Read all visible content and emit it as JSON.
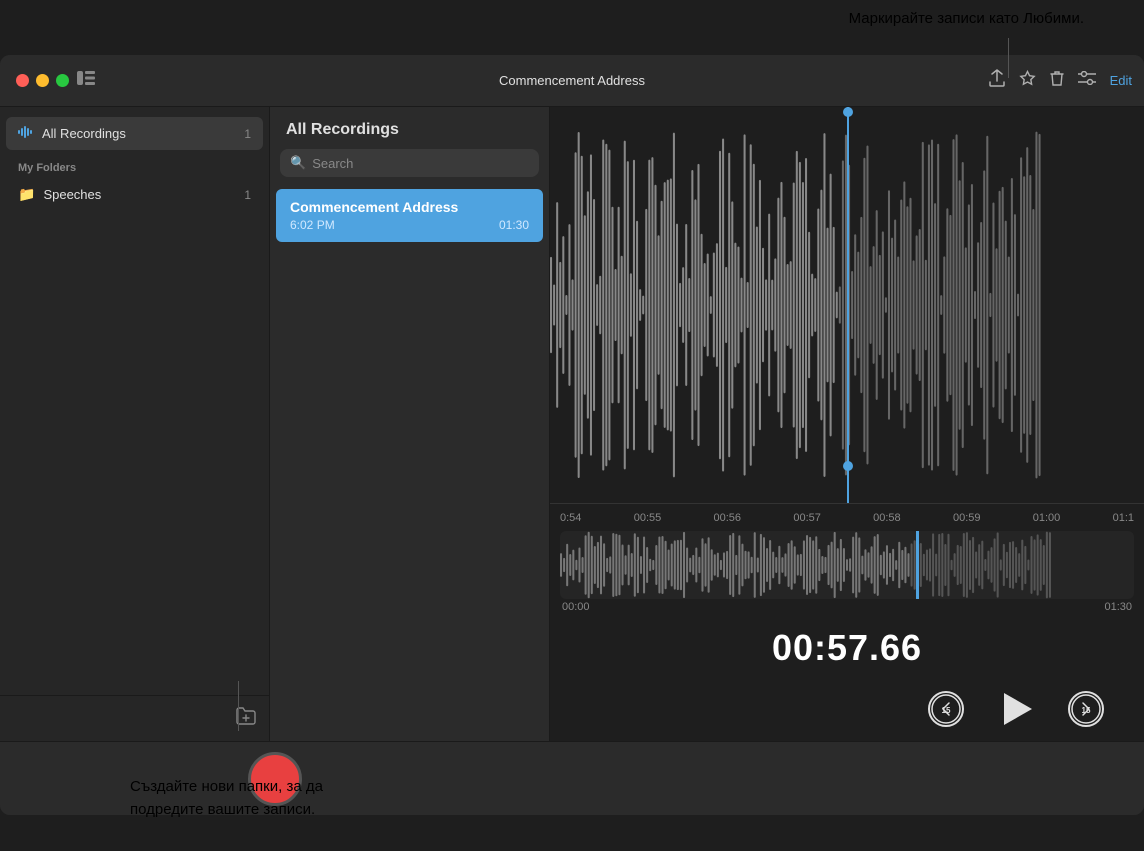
{
  "tooltip_top": "Маркирайте записи като Любими.",
  "tooltip_bottom_line1": "Създайте нови папки, за да",
  "tooltip_bottom_line2": "подредите вашите записи.",
  "window": {
    "title": "Commencement Address",
    "edit_label": "Edit"
  },
  "left_sidebar": {
    "all_recordings_label": "All Recordings",
    "all_recordings_badge": "1",
    "my_folders_label": "My Folders",
    "folder_name": "Speeches",
    "folder_badge": "1"
  },
  "middle_panel": {
    "header": "All Recordings",
    "search_placeholder": "Search",
    "recording_name": "Commencement Address",
    "recording_time": "6:02 PM",
    "recording_duration": "01:30"
  },
  "waveform": {
    "ruler_marks": [
      "0:54",
      "00:55",
      "00:56",
      "00:57",
      "00:58",
      "00:59",
      "01:00",
      "01:1"
    ],
    "mini_start": "00:00",
    "mini_end": "01:30"
  },
  "timer": {
    "display": "00:57.66"
  },
  "controls": {
    "skip_back_label": "15",
    "skip_forward_label": "15"
  }
}
